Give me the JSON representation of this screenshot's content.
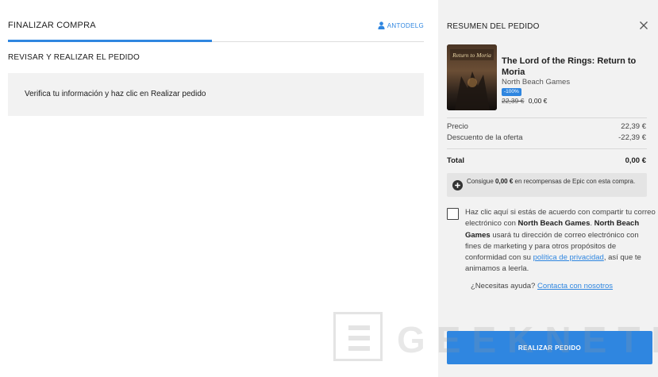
{
  "checkout": {
    "tab_title": "FINALIZAR COMPRA",
    "username": "ANTODELG",
    "section_title": "REVISAR Y REALIZAR EL PEDIDO",
    "info_text": "Verifica tu información y haz clic en Realizar pedido"
  },
  "summary": {
    "title": "RESUMEN DEL PEDIDO",
    "product": {
      "title": "The Lord of the Rings: Return to Moria",
      "cover_text": "Return to Moria",
      "publisher": "North Beach Games",
      "discount_badge": "-100%",
      "old_price": "22,39 €",
      "new_price": "0,00 €"
    },
    "price_label": "Precio",
    "price_value": "22,39 €",
    "discount_label": "Descuento de la oferta",
    "discount_value": "-22,39 €",
    "total_label": "Total",
    "total_value": "0,00 €",
    "rewards": {
      "prefix": "Consigue",
      "amount": "0,00 €",
      "suffix": "en recompensas de Epic con esta compra."
    },
    "consent": {
      "part1": "Haz clic aquí si estás de acuerdo con compartir tu correo electrónico con",
      "company1": "North Beach Games",
      "company2": "North Beach Games",
      "part2": "usará tu dirección de correo electrónico con fines de marketing y para otros propósitos de conformidad con su",
      "link": "política de privacidad",
      "part3": ", así que te animamos a leerla."
    },
    "help_prefix": "¿Necesitas ayuda?",
    "help_link": "Contacta con nosotros",
    "cta_label": "REALIZAR PEDIDO"
  },
  "watermark": {
    "text": "GEEKNETIC"
  },
  "colors": {
    "accent": "#2f86e0",
    "panel_bg": "#f2f2f2",
    "text": "#202020"
  },
  "icons": {
    "user": "user-icon",
    "close": "close-icon",
    "rewards": "plus-circle-icon"
  }
}
